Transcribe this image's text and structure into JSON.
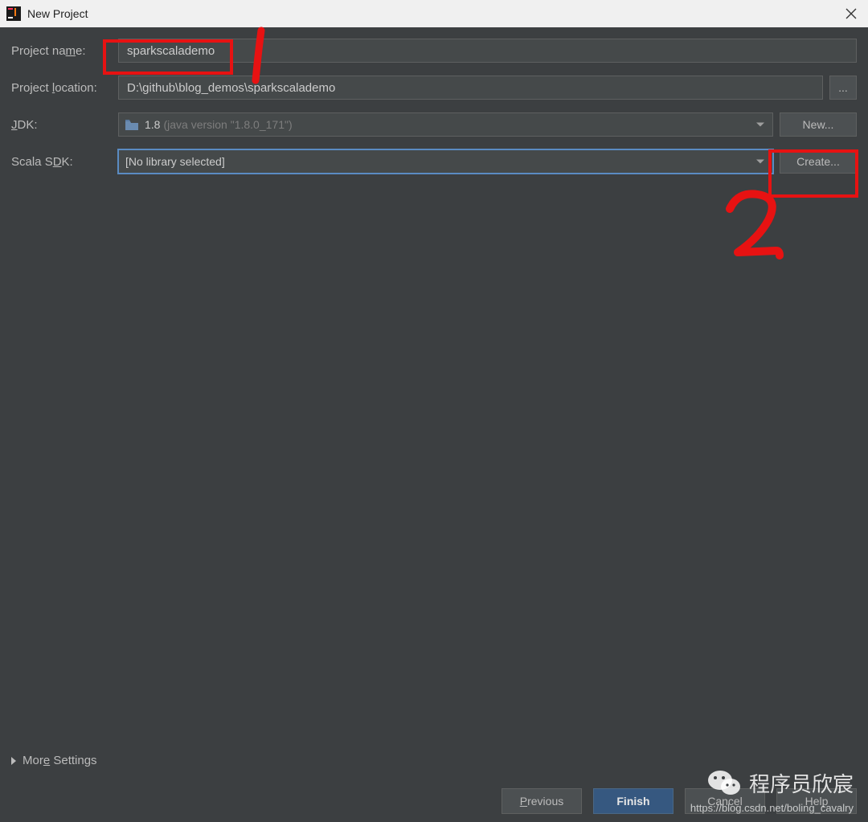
{
  "titlebar": {
    "title": "New Project"
  },
  "labels": {
    "projectName": "Project name:",
    "projectLocation": "Project location:",
    "jdk": "JDK:",
    "scalaSdk": "Scala SDK:",
    "moreSettings": "More Settings"
  },
  "fields": {
    "projectName": "sparkscalademo",
    "projectLocation": "D:\\github\\blog_demos\\sparkscalademo",
    "jdkVersion": "1.8",
    "jdkDetail": "(java version \"1.8.0_171\")",
    "scalaSdk": "[No library selected]"
  },
  "buttons": {
    "browse": "...",
    "new": "New...",
    "create": "Create...",
    "previous": "Previous",
    "finish": "Finish",
    "cancel": "Cancel",
    "help": "Help"
  },
  "annotations": {
    "one": "1",
    "two": "2"
  },
  "watermark": {
    "text": "程序员欣宸",
    "url": "https://blog.csdn.net/boling_cavalry"
  }
}
